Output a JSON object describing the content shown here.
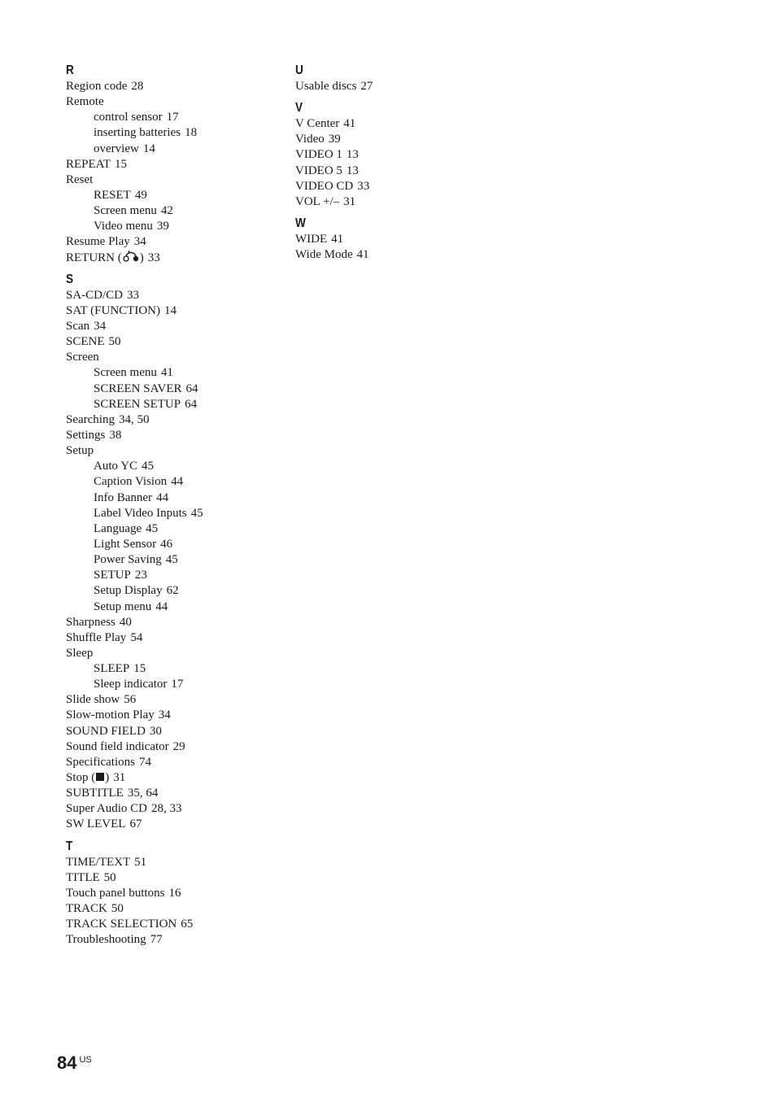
{
  "columns": [
    [
      {
        "letter": "R",
        "entries": [
          {
            "term": "Region code",
            "pages": "28",
            "level": 0
          },
          {
            "term": "Remote",
            "pages": "",
            "level": 0
          },
          {
            "term": "control sensor",
            "pages": "17",
            "level": 1
          },
          {
            "term": "inserting batteries",
            "pages": "18",
            "level": 1
          },
          {
            "term": "overview",
            "pages": "14",
            "level": 1
          },
          {
            "term": "REPEAT",
            "pages": "15",
            "level": 0
          },
          {
            "term": "Reset",
            "pages": "",
            "level": 0
          },
          {
            "term": "RESET",
            "pages": "49",
            "level": 1
          },
          {
            "term": "Screen menu",
            "pages": "42",
            "level": 1
          },
          {
            "term": "Video menu",
            "pages": "39",
            "level": 1
          },
          {
            "term": "Resume Play",
            "pages": "34",
            "level": 0
          },
          {
            "term": "RETURN (",
            "icon": "return-arrow-icon",
            "term_after": ")",
            "pages": "33",
            "level": 0
          }
        ]
      },
      {
        "letter": "S",
        "entries": [
          {
            "term": "SA-CD/CD",
            "pages": "33",
            "level": 0
          },
          {
            "term": "SAT (FUNCTION)",
            "pages": "14",
            "level": 0
          },
          {
            "term": "Scan",
            "pages": "34",
            "level": 0
          },
          {
            "term": "SCENE",
            "pages": "50",
            "level": 0
          },
          {
            "term": "Screen",
            "pages": "",
            "level": 0
          },
          {
            "term": "Screen menu",
            "pages": "41",
            "level": 1
          },
          {
            "term": "SCREEN SAVER",
            "pages": "64",
            "level": 1
          },
          {
            "term": "SCREEN SETUP",
            "pages": "64",
            "level": 1
          },
          {
            "term": "Searching",
            "pages": "34, 50",
            "level": 0
          },
          {
            "term": "Settings",
            "pages": "38",
            "level": 0
          },
          {
            "term": "Setup",
            "pages": "",
            "level": 0
          },
          {
            "term": "Auto YC",
            "pages": "45",
            "level": 1
          },
          {
            "term": "Caption Vision",
            "pages": "44",
            "level": 1
          },
          {
            "term": "Info Banner",
            "pages": "44",
            "level": 1
          },
          {
            "term": "Label Video Inputs",
            "pages": "45",
            "level": 1
          },
          {
            "term": "Language",
            "pages": "45",
            "level": 1
          },
          {
            "term": "Light Sensor",
            "pages": "46",
            "level": 1
          },
          {
            "term": "Power Saving",
            "pages": "45",
            "level": 1
          },
          {
            "term": "SETUP",
            "pages": "23",
            "level": 1
          },
          {
            "term": "Setup Display",
            "pages": "62",
            "level": 1
          },
          {
            "term": "Setup menu",
            "pages": "44",
            "level": 1
          },
          {
            "term": "Sharpness",
            "pages": "40",
            "level": 0
          },
          {
            "term": "Shuffle Play",
            "pages": "54",
            "level": 0
          },
          {
            "term": "Sleep",
            "pages": "",
            "level": 0
          },
          {
            "term": "SLEEP",
            "pages": "15",
            "level": 1
          },
          {
            "term": "Sleep indicator",
            "pages": "17",
            "level": 1
          },
          {
            "term": "Slide show",
            "pages": "56",
            "level": 0
          },
          {
            "term": "Slow-motion Play",
            "pages": "34",
            "level": 0
          },
          {
            "term": "SOUND FIELD",
            "pages": "30",
            "level": 0
          },
          {
            "term": "Sound field indicator",
            "pages": "29",
            "level": 0
          },
          {
            "term": "Specifications",
            "pages": "74",
            "level": 0
          },
          {
            "term": "Stop (",
            "icon": "stop-square-icon",
            "term_after": ")",
            "pages": "31",
            "level": 0
          },
          {
            "term": "SUBTITLE",
            "pages": "35, 64",
            "level": 0
          },
          {
            "term": "Super Audio CD",
            "pages": "28, 33",
            "level": 0
          },
          {
            "term": "SW LEVEL",
            "pages": "67",
            "level": 0
          }
        ]
      },
      {
        "letter": "T",
        "entries": [
          {
            "term": "TIME/TEXT",
            "pages": "51",
            "level": 0
          },
          {
            "term": "TITLE",
            "pages": "50",
            "level": 0
          },
          {
            "term": "Touch panel buttons",
            "pages": "16",
            "level": 0
          },
          {
            "term": "TRACK",
            "pages": "50",
            "level": 0
          },
          {
            "term": "TRACK SELECTION",
            "pages": "65",
            "level": 0
          },
          {
            "term": "Troubleshooting",
            "pages": "77",
            "level": 0
          }
        ]
      }
    ],
    [
      {
        "letter": "U",
        "entries": [
          {
            "term": "Usable discs",
            "pages": "27",
            "level": 0
          }
        ]
      },
      {
        "letter": "V",
        "entries": [
          {
            "term": "V Center",
            "pages": "41",
            "level": 0
          },
          {
            "term": "Video",
            "pages": "39",
            "level": 0
          },
          {
            "term": "VIDEO 1",
            "pages": "13",
            "level": 0
          },
          {
            "term": "VIDEO 5",
            "pages": "13",
            "level": 0
          },
          {
            "term": "VIDEO CD",
            "pages": "33",
            "level": 0
          },
          {
            "term": "VOL +/–",
            "pages": "31",
            "level": 0
          }
        ]
      },
      {
        "letter": "W",
        "entries": [
          {
            "term": "WIDE",
            "pages": "41",
            "level": 0
          },
          {
            "term": "Wide Mode",
            "pages": "41",
            "level": 0
          }
        ]
      }
    ]
  ],
  "footer": {
    "page_number": "84",
    "suffix": "US"
  }
}
